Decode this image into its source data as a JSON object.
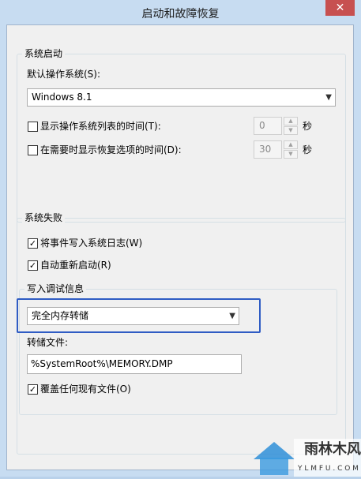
{
  "window": {
    "title": "启动和故障恢复",
    "close_symbol": "✕"
  },
  "startup": {
    "group_title": "系统启动",
    "default_os_label": "默认操作系统(S):",
    "default_os_value": "Windows 8.1",
    "show_os_list_label": "显示操作系统列表的时间(T):",
    "show_os_list_checked": false,
    "show_os_list_value": "0",
    "show_recovery_label": "在需要时显示恢复选项的时间(D):",
    "show_recovery_checked": false,
    "show_recovery_value": "30",
    "seconds_unit": "秒"
  },
  "failure": {
    "group_title": "系统失败",
    "write_event_label": "将事件写入系统日志(W)",
    "write_event_checked": true,
    "auto_restart_label": "自动重新启动(R)",
    "auto_restart_checked": true,
    "debug_group_title": "写入调试信息",
    "debug_type_value": "完全内存转储",
    "dump_file_label": "转储文件:",
    "dump_file_value": "%SystemRoot%\\MEMORY.DMP",
    "overwrite_label": "覆盖任何现有文件(O)",
    "overwrite_checked": true
  },
  "watermark": {
    "brand": "雨林木风",
    "url": "Y L M F U . C O M"
  },
  "colors": {
    "highlight_border": "#2f5cc4",
    "close_button": "#c75050"
  }
}
